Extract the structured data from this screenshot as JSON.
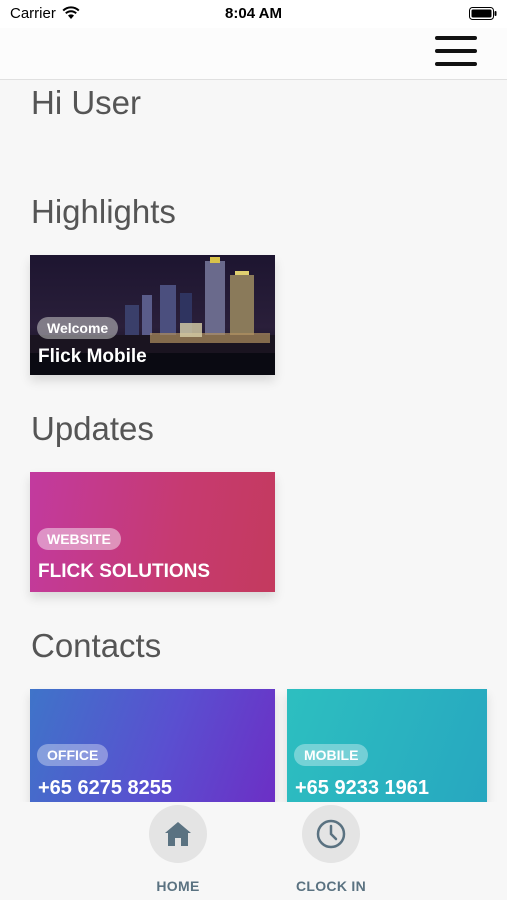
{
  "status_bar": {
    "carrier": "Carrier",
    "time": "8:04 AM"
  },
  "greeting": "Hi User",
  "sections": {
    "highlights": "Highlights",
    "updates": "Updates",
    "contacts": "Contacts"
  },
  "highlight_card": {
    "badge": "Welcome",
    "title": "Flick Mobile"
  },
  "update_card": {
    "badge": "WEBSITE",
    "title": "FLICK SOLUTIONS"
  },
  "contacts": [
    {
      "badge": "OFFICE",
      "value": "+65 6275 8255"
    },
    {
      "badge": "MOBILE",
      "value": "+65 9233 1961"
    }
  ],
  "tabs": [
    {
      "label": "HOME",
      "icon": "home-icon"
    },
    {
      "label": "CLOCK IN",
      "icon": "clock-icon"
    }
  ],
  "colors": {
    "tab_label": "#5a7281",
    "update_gradient_start": "#c23a9f",
    "update_gradient_end": "#c43a5e",
    "office_gradient_start": "#3f74c9",
    "office_gradient_end": "#6c2fc5",
    "mobile_gradient_start": "#2dbfc0",
    "mobile_gradient_end": "#27a7c0"
  }
}
